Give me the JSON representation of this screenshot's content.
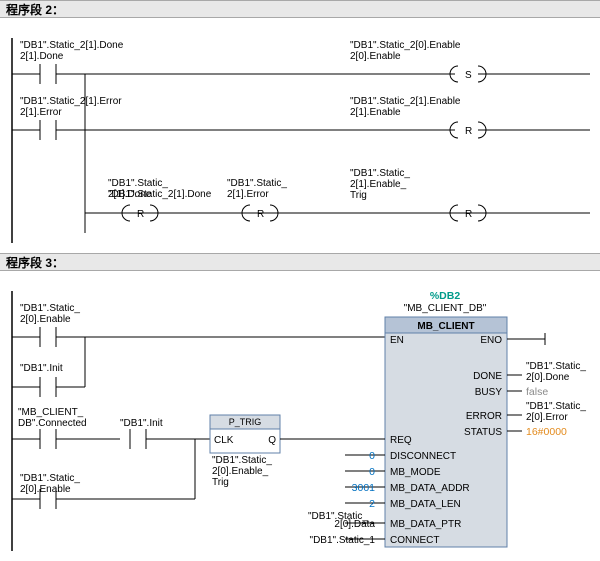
{
  "network2": {
    "header": "程序段 2：",
    "rung1": {
      "contact": "\"DB1\".Static_2[1].Done",
      "coil": "\"DB1\".Static_2[0].Enable",
      "coilType": "S"
    },
    "rung2": {
      "contact": "\"DB1\".Static_2[1].Error",
      "coil": "\"DB1\".Static_2[1].Enable",
      "coilType": "R"
    },
    "rung3": {
      "reset1": "\"DB1\".Static_2[1].Done",
      "reset2": "\"DB1\".Static_2[1].Error",
      "reset3": "\"DB1\".Static_2[1].Enable_Trig"
    }
  },
  "network3": {
    "header": "程序段 3：",
    "enContact1": "\"DB1\".Static_2[0].Enable",
    "enContact2": "\"DB1\".Init",
    "reqContact1": "\"MB_CLIENT_DB\".Connected",
    "reqContact2": "\"DB1\".Init",
    "reqContact3": "\"DB1\".Static_2[0].Enable",
    "ptrig": {
      "title": "P_TRIG",
      "clk": "CLK",
      "q": "Q",
      "mem": "\"DB1\".Static_2[0].Enable_Trig"
    },
    "block": {
      "instDB_sym": "%DB2",
      "instDB_name": "\"MB_CLIENT_DB\"",
      "title": "MB_CLIENT",
      "inputs": {
        "EN": "EN",
        "REQ": "REQ",
        "DISCONNECT": "DISCONNECT",
        "MB_MODE": "MB_MODE",
        "MB_DATA_ADDR": "MB_DATA_ADDR",
        "MB_DATA_LEN": "MB_DATA_LEN",
        "MB_DATA_PTR": "MB_DATA_PTR",
        "CONNECT": "CONNECT"
      },
      "outputs": {
        "ENO": "ENO",
        "DONE": "DONE",
        "BUSY": "BUSY",
        "ERROR": "ERROR",
        "STATUS": "STATUS"
      },
      "vals": {
        "DISCONNECT": "0",
        "MB_MODE": "0",
        "MB_DATA_ADDR": "3001",
        "MB_DATA_LEN": "2",
        "MB_DATA_PTR": "\"DB1\".Static_2[0].Data",
        "CONNECT": "\"DB1\".Static_1"
      },
      "outvals": {
        "DONE": "\"DB1\".Static_2[0].Done",
        "BUSY": "false",
        "ERROR": "\"DB1\".Static_2[0].Error",
        "STATUS": "16#0000"
      }
    }
  }
}
